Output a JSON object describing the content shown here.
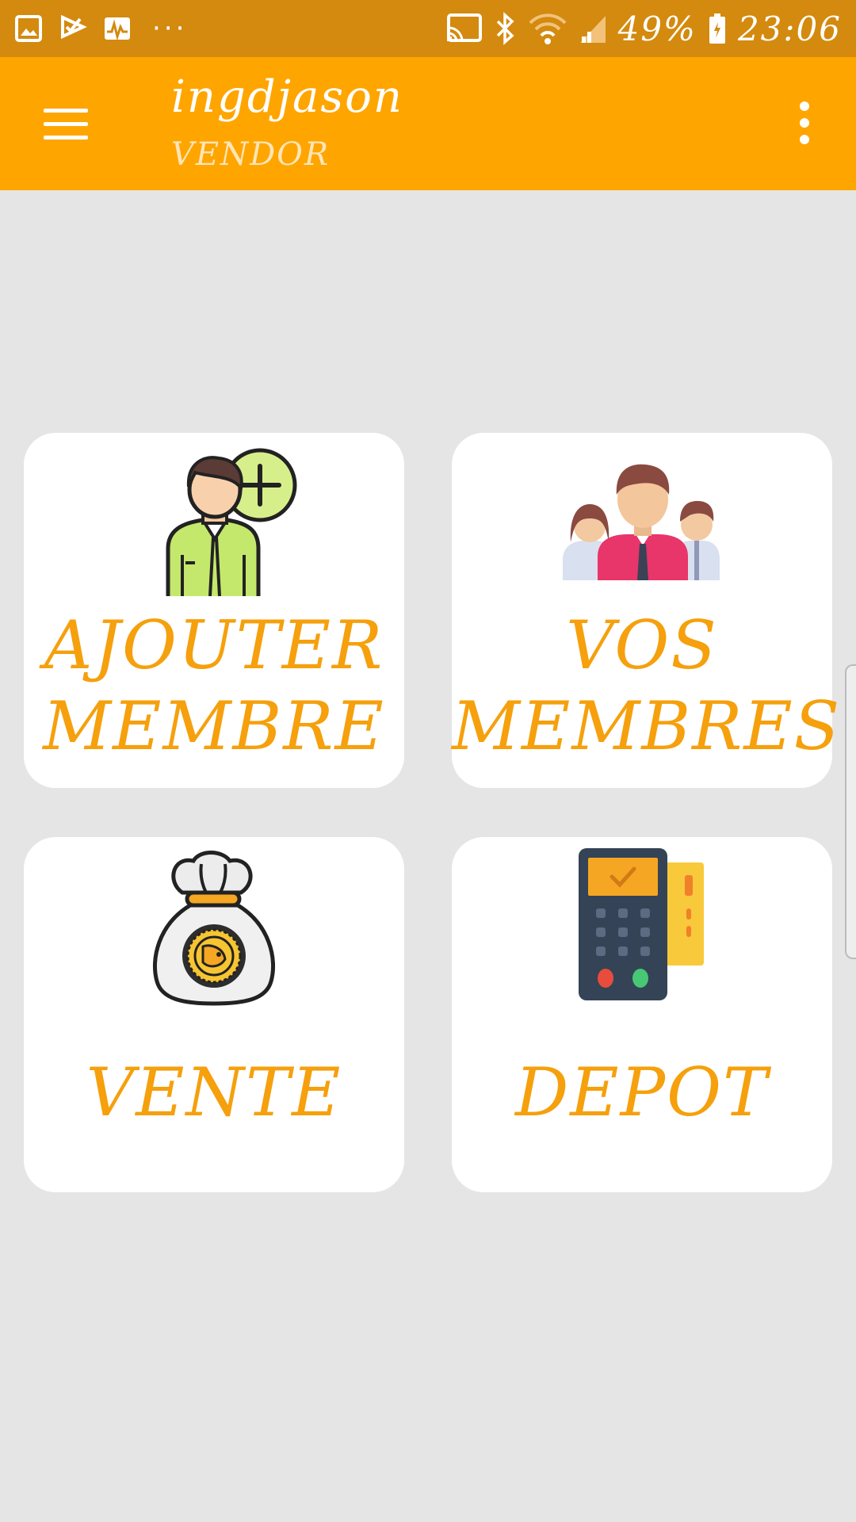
{
  "status_bar": {
    "left_icons": [
      "image-icon",
      "check-flag-icon",
      "activity-icon",
      "more-dots-icon"
    ],
    "more_dots": "···",
    "right_icons": [
      "cast-icon",
      "bluetooth-icon",
      "wifi-icon",
      "signal-icon",
      "battery-icon"
    ],
    "battery_text": "49%",
    "time": "23:06"
  },
  "app_bar": {
    "menu_icon": "hamburger-menu-icon",
    "title": "ingdjason",
    "subtitle": "VENDOR",
    "overflow_icon": "more-vert-icon",
    "background": "#ffa500"
  },
  "tiles": [
    {
      "id": "ajouter-membre",
      "icon": "add-member-icon",
      "line1": "AJOUTER",
      "line2": "MEMBRE"
    },
    {
      "id": "vos-membres",
      "icon": "members-group-icon",
      "line1": "VOS",
      "line2": "MEMBRES"
    },
    {
      "id": "vente",
      "icon": "money-bag-icon",
      "line1": "VENTE"
    },
    {
      "id": "depot",
      "icon": "payment-terminal-icon",
      "line1": "DEPOT"
    }
  ],
  "colors": {
    "status_bar": "#d38a0e",
    "accent": "#ffa500",
    "tile_label": "#f5a00c",
    "background": "#e5e5e5"
  }
}
